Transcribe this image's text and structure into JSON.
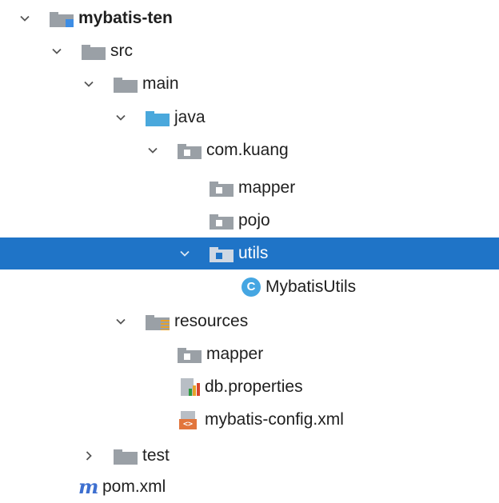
{
  "project_tree": {
    "rows": [
      {
        "label": "mybatis-ten",
        "icon": "module-folder-icon",
        "expanded": true
      },
      {
        "label": "src",
        "icon": "folder-icon",
        "expanded": true
      },
      {
        "label": "main",
        "icon": "folder-icon",
        "expanded": true
      },
      {
        "label": "java",
        "icon": "source-root-folder-icon",
        "expanded": true
      },
      {
        "label": "com.kuang",
        "icon": "package-icon",
        "expanded": true
      },
      {
        "label": "mapper",
        "icon": "package-icon"
      },
      {
        "label": "pojo",
        "icon": "package-icon"
      },
      {
        "label": "utils",
        "icon": "package-icon",
        "expanded": true,
        "selected": true
      },
      {
        "label": "MybatisUtils",
        "icon": "java-class-icon",
        "icon_letter": "C"
      },
      {
        "label": "resources",
        "icon": "resources-folder-icon",
        "expanded": true
      },
      {
        "label": "mapper",
        "icon": "folder-icon"
      },
      {
        "label": "db.properties",
        "icon": "properties-file-icon"
      },
      {
        "label": "mybatis-config.xml",
        "icon": "xml-file-icon",
        "icon_text": "<>"
      },
      {
        "label": "test",
        "icon": "folder-icon",
        "expanded": false
      },
      {
        "label": "pom.xml",
        "icon": "maven-file-icon",
        "icon_letter": "m"
      }
    ]
  },
  "colors": {
    "selection_background": "#1f74c7",
    "folder_gray": "#9aa0a6",
    "source_root_blue": "#4aa8dc",
    "class_icon_blue": "#45a6e2",
    "maven_blue": "#3d6fd0",
    "xml_badge_orange": "#e2753c"
  }
}
